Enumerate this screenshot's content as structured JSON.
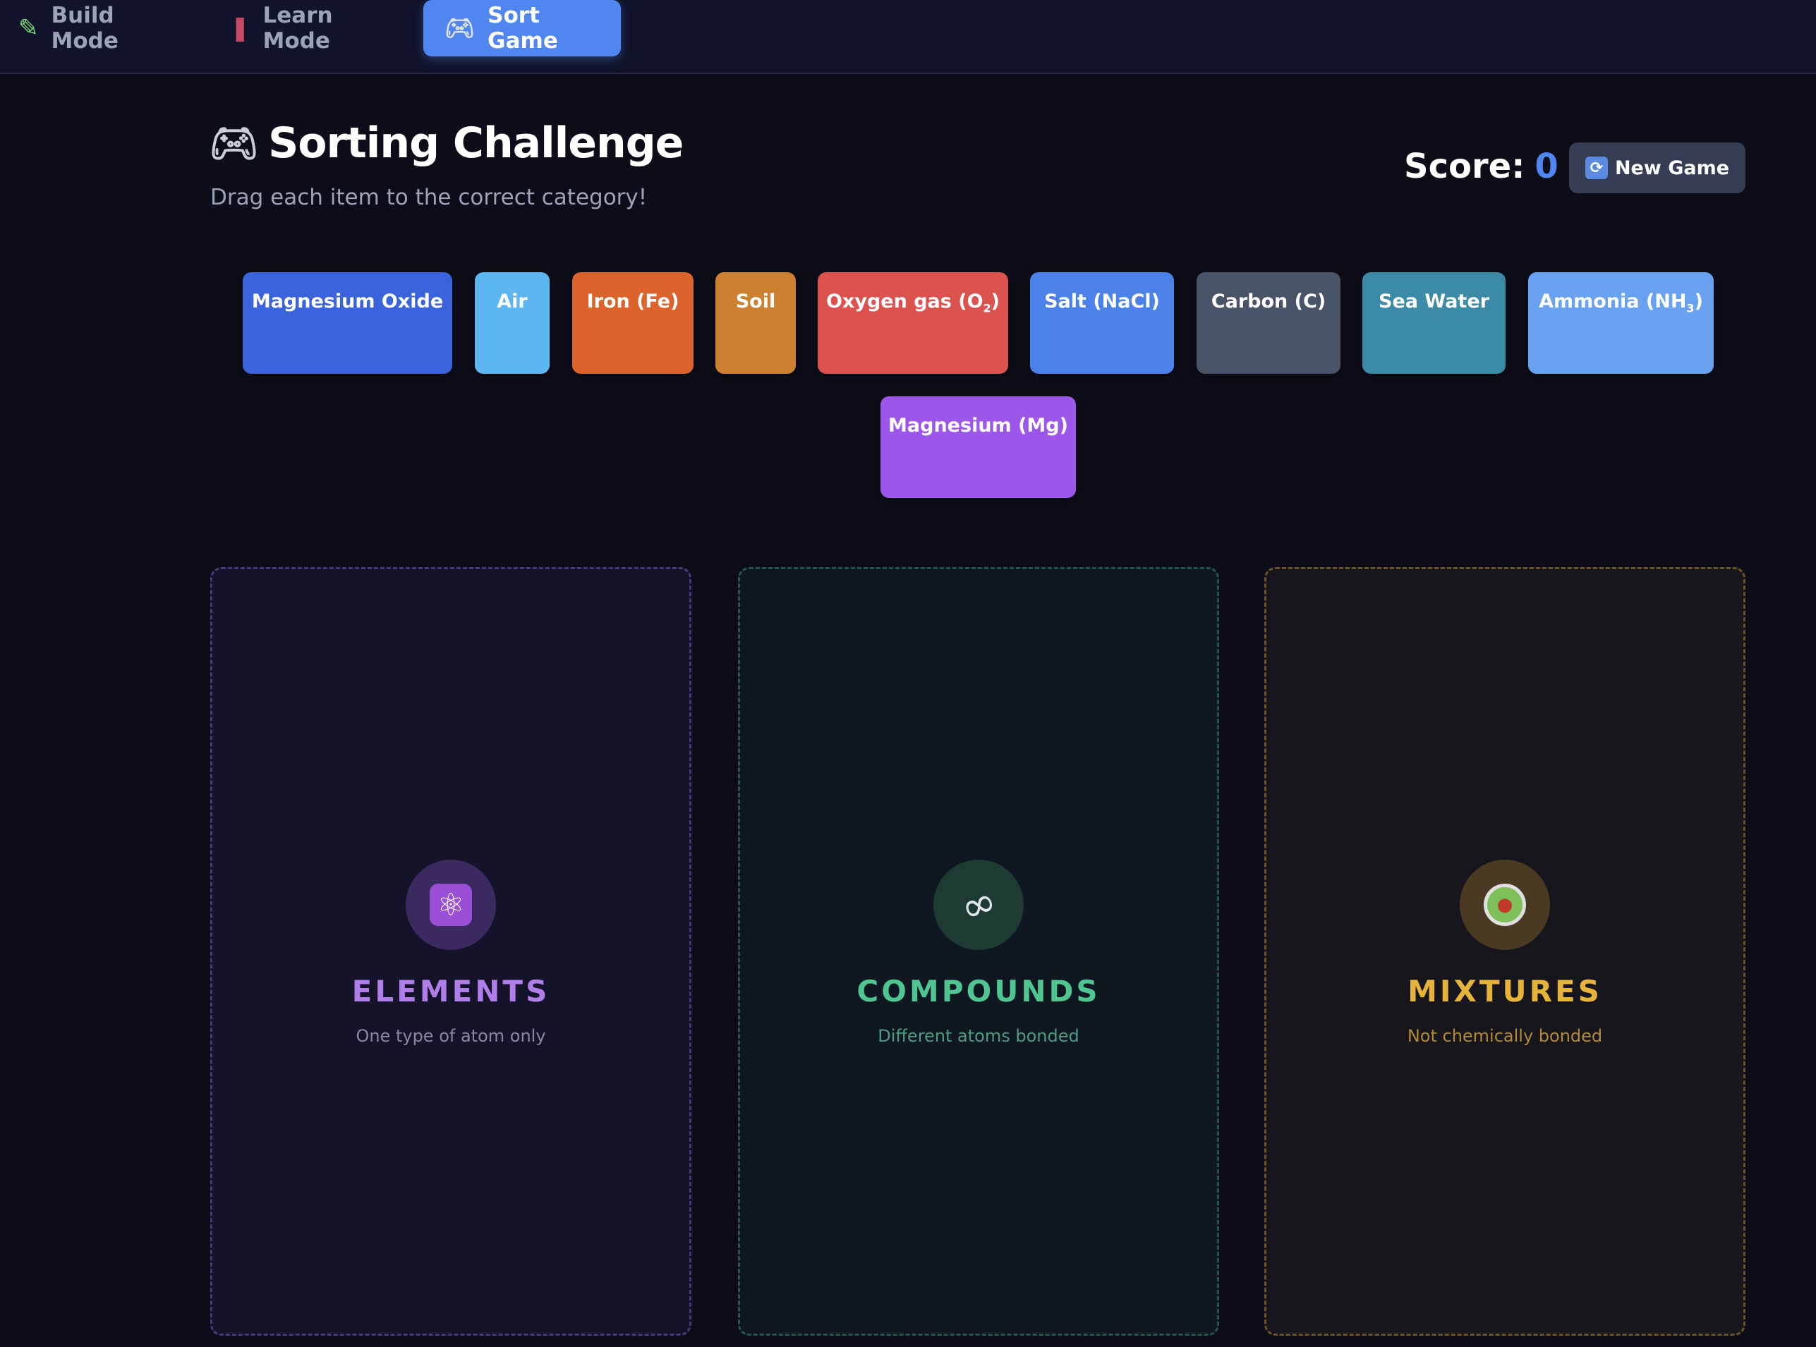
{
  "nav": {
    "tabs": [
      {
        "label": "Build Mode",
        "icon": "pencil-icon",
        "active": false
      },
      {
        "label": "Learn Mode",
        "icon": "book-icon",
        "active": false
      },
      {
        "label": "Sort Game",
        "icon": "gamepad-icon",
        "active": true
      }
    ]
  },
  "header": {
    "icon": "gamepad-icon",
    "title": "Sorting Challenge",
    "subtitle": "Drag each item to the correct category!",
    "score_label": "Score:",
    "score_value": "0",
    "new_game_label": "New Game",
    "new_game_icon": "refresh-icon"
  },
  "items": [
    {
      "label": "Magnesium Oxide",
      "color": "#3a63dc"
    },
    {
      "label": "Air",
      "color": "#5eb6f0"
    },
    {
      "label": "Iron (Fe)",
      "color": "#dc642c"
    },
    {
      "label": "Soil",
      "color": "#cc8030"
    },
    {
      "label": "Oxygen gas (O",
      "sub": "2",
      "suffix": ")",
      "color": "#dc524e"
    },
    {
      "label": "Salt (NaCl)",
      "color": "#4b82ea"
    },
    {
      "label": "Carbon (C)",
      "color": "#4a5468"
    },
    {
      "label": "Sea Water",
      "color": "#3b8aa6"
    },
    {
      "label": "Ammonia (NH",
      "sub": "3",
      "suffix": ")",
      "color": "#6aa2f2"
    },
    {
      "label": "Magnesium (Mg)",
      "color": "#9d56ea"
    }
  ],
  "zones": [
    {
      "title": "ELEMENTS",
      "description": "One type of atom only",
      "icon": "atom-icon",
      "title_color": "#b07ee8",
      "desc_color": "#8a86a8"
    },
    {
      "title": "COMPOUNDS",
      "description": "Different atoms bonded",
      "icon": "link-icon",
      "title_color": "#4fc591",
      "desc_color": "#4f9a80"
    },
    {
      "title": "MIXTURES",
      "description": "Not chemically bonded",
      "icon": "bowl-icon",
      "title_color": "#e7b43a",
      "desc_color": "#b08a3a"
    }
  ]
}
